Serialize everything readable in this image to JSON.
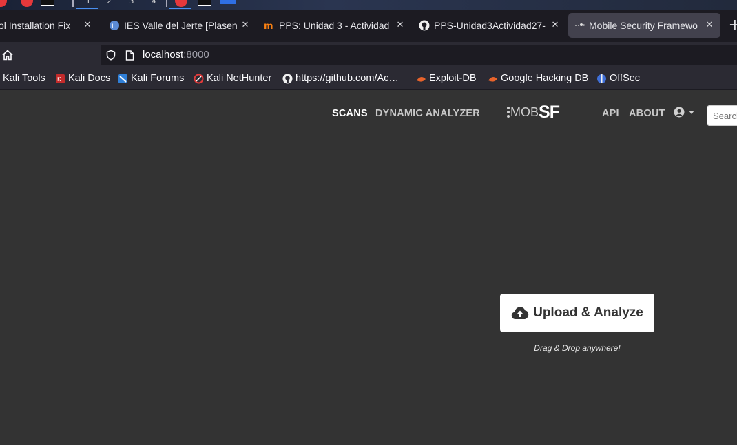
{
  "taskbar": {
    "workspaces": [
      "1",
      "2",
      "3",
      "4"
    ]
  },
  "tabs": [
    {
      "label": "ol Installation Fix",
      "favicon": "doc-icon",
      "active": false
    },
    {
      "label": "IES Valle del Jerte [Plasen",
      "favicon": "moodle-icon",
      "active": false
    },
    {
      "label": "PPS: Unidad 3 - Actividad",
      "favicon": "moodle-m-icon",
      "active": false
    },
    {
      "label": "PPS-Unidad3Actividad27-",
      "favicon": "github-icon",
      "active": false
    },
    {
      "label": "Mobile Security Framewo",
      "favicon": "mobsf-icon",
      "active": true
    }
  ],
  "new_tab_label": "+",
  "navbar": {
    "url_host": "localhost",
    "url_port": ":8000"
  },
  "bookmarks": [
    {
      "label": "Kali Tools",
      "icon": "kali-icon"
    },
    {
      "label": "Kali Docs",
      "icon": "kali-docs-icon"
    },
    {
      "label": "Kali Forums",
      "icon": "kali-forums-icon"
    },
    {
      "label": "Kali NetHunter",
      "icon": "nethunter-icon"
    },
    {
      "label": "https://github.com/Ac…",
      "icon": "github-icon"
    },
    {
      "label": "Exploit-DB",
      "icon": "exploitdb-icon"
    },
    {
      "label": "Google Hacking DB",
      "icon": "ghdb-icon"
    },
    {
      "label": "OffSec",
      "icon": "offsec-icon"
    }
  ],
  "app": {
    "nav": {
      "scans": "SCANS",
      "dynamic_analyzer": "DYNAMIC ANALYZER",
      "api": "API",
      "about": "ABOUT"
    },
    "logo": {
      "mob": "MOB",
      "sf": "SF"
    },
    "search_placeholder": "Search",
    "upload_label": "Upload & Analyze",
    "drag_drop_hint": "Drag & Drop anywhere!"
  },
  "colors": {
    "page_background": "#333333",
    "tab_bar": "#1c1b22",
    "toolbar": "#2b2a33",
    "active_tab": "#42414d",
    "button_background": "#ffffff"
  }
}
